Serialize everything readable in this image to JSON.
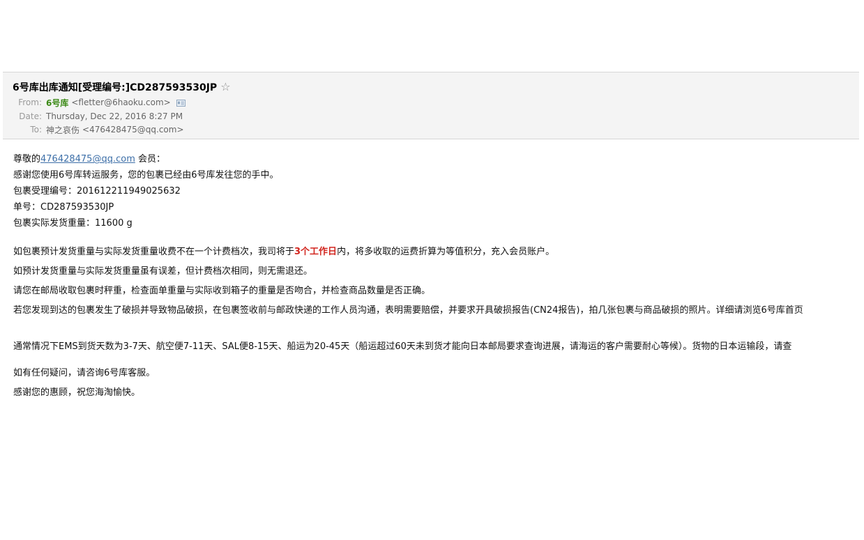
{
  "header": {
    "subject": "6号库出库通知[受理编号:]CD287593530JP",
    "from_label": "From:",
    "from_name": "6号库",
    "from_email": "<fletter@6haoku.com>",
    "date_label": "Date:",
    "date_value": "Thursday, Dec 22, 2016 8:27 PM",
    "to_label": "To:",
    "to_name": "神之哀伤",
    "to_email": "<476428475@qq.com>"
  },
  "body": {
    "greeting_prefix": "尊敬的",
    "greeting_email": "476428475@qq.com",
    "greeting_suffix": " 会员：",
    "line_thanks": "感谢您使用6号库转运服务，您的包裹已经由6号库发往您的手中。",
    "line_receipt": "包裹受理编号：201612211949025632",
    "line_tracking": "单号：CD287593530JP",
    "line_weight": "包裹实际发货重量：11600 g",
    "refund_prefix": "如包裹预计发货重量与实际发货重量收费不在一个计费档次，我司将于",
    "refund_highlight": "3个工作日",
    "refund_suffix": "内，将多收取的运费折算为等值积分，充入会员账户。",
    "line_same_tier": "如预计发货重量与实际发货重量虽有误差，但计费档次相同，则无需退还。",
    "line_check": "请您在邮局收取包裹时秤重，检查面单重量与实际收到箱子的重量是否吻合，并检查商品数量是否正确。",
    "line_damage": "若您发现到达的包裹发生了破损并导致物品破损，在包裹签收前与邮政快递的工作人员沟通，表明需要赔偿，并要求开具破损报告(CN24报告)，拍几张包裹与商品破损的照片。详细请浏览6号库首页",
    "line_delivery": "通常情况下EMS到货天数为3-7天、航空便7-11天、SAL便8-15天、船运为20-45天（船运超过60天未到货才能向日本邮局要求查询进展，请海运的客户需要耐心等候）。货物的日本运输段，请查",
    "line_questions": "如有任何疑问，请咨询6号库客服。",
    "line_closing": "感谢您的惠顾，祝您海淘愉快。"
  },
  "icons": {
    "star": "star-outline-icon",
    "contact_card": "contact-card-icon"
  },
  "colors": {
    "sender_name": "#3c8a17",
    "highlight": "#d2261f",
    "link": "#3d6fa8"
  }
}
